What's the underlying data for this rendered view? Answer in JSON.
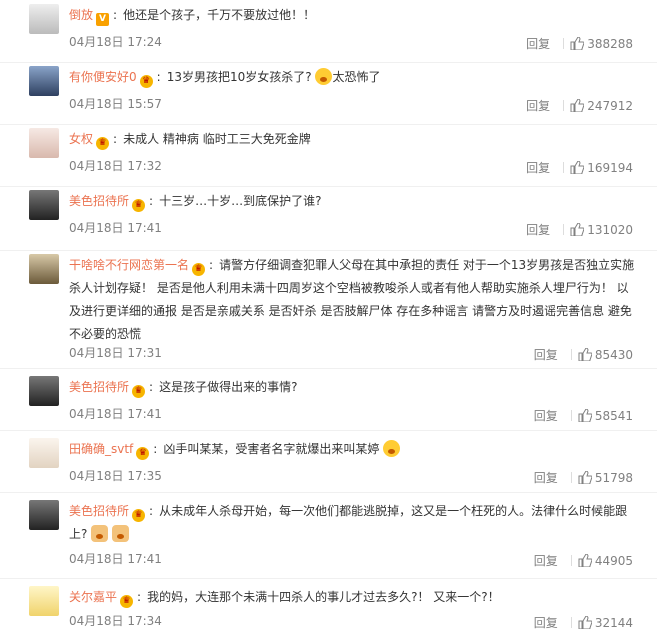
{
  "comments": [
    {
      "username": "倒放",
      "badge": "V",
      "text": "他还是个孩子，千万不要放过他！！",
      "time": "04月18日 17:24",
      "reply": "回复",
      "likes": "388288",
      "emoji": ""
    },
    {
      "username": "有你便安好0",
      "badge": "crown",
      "text": "13岁男孩把10岁女孩杀了?",
      "time": "04月18日 15:57",
      "reply": "回复",
      "likes": "247912",
      "emoji": "太恐怖了"
    },
    {
      "username": "女权",
      "badge": "crown",
      "text": "未成人 精神病 临时工三大免死金牌",
      "time": "04月18日 17:32",
      "reply": "回复",
      "likes": "169194",
      "emoji": ""
    },
    {
      "username": "美色招待所",
      "badge": "crown",
      "text": "十三岁…十岁…到底保护了谁?",
      "time": "04月18日 17:41",
      "reply": "回复",
      "likes": "131020",
      "emoji": ""
    },
    {
      "username": "干啥啥不行网恋第一名",
      "badge": "crown",
      "text": "请警方仔细调查犯罪人父母在其中承担的责任 对于一个13岁男孩是否独立实施杀人计划存疑！ 是否是他人利用未满十四周岁这个空档被教唆杀人或者有他人帮助实施杀人埋尸行为！ 以及进行更详细的通报 是否是亲戚关系 是否奸杀 是否肢解尸体 存在多种谣言 请警方及时遏谣完善信息 避免不必要的恐慌",
      "time": "04月18日 17:31",
      "reply": "回复",
      "likes": "85430",
      "emoji": ""
    },
    {
      "username": "美色招待所",
      "badge": "crown",
      "text": "这是孩子做得出来的事情?",
      "time": "04月18日 17:41",
      "reply": "回复",
      "likes": "58541",
      "emoji": ""
    },
    {
      "username": "田确确_svtf",
      "badge": "crown",
      "text": "凶手叫某某，受害者名字就爆出来叫某婷",
      "time": "04月18日 17:35",
      "reply": "回复",
      "likes": "51798",
      "emoji": ""
    },
    {
      "username": "美色招待所",
      "badge": "crown",
      "text": "从未成年人杀母开始，每一次他们都能逃脱掉，这又是一个枉死的人。法律什么时候能跟上?",
      "time": "04月18日 17:41",
      "reply": "回复",
      "likes": "44905",
      "emoji": ""
    },
    {
      "username": "关尔嘉平",
      "badge": "crown",
      "text": "我的妈，大连那个未满十四杀人的事儿才过去多久?！ 又来一个?！",
      "time": "04月18日 17:34",
      "reply": "回复",
      "likes": "32144",
      "emoji": ""
    }
  ],
  "colors": {
    "username": "#eb7350",
    "meta": "#808080",
    "text": "#333333"
  }
}
